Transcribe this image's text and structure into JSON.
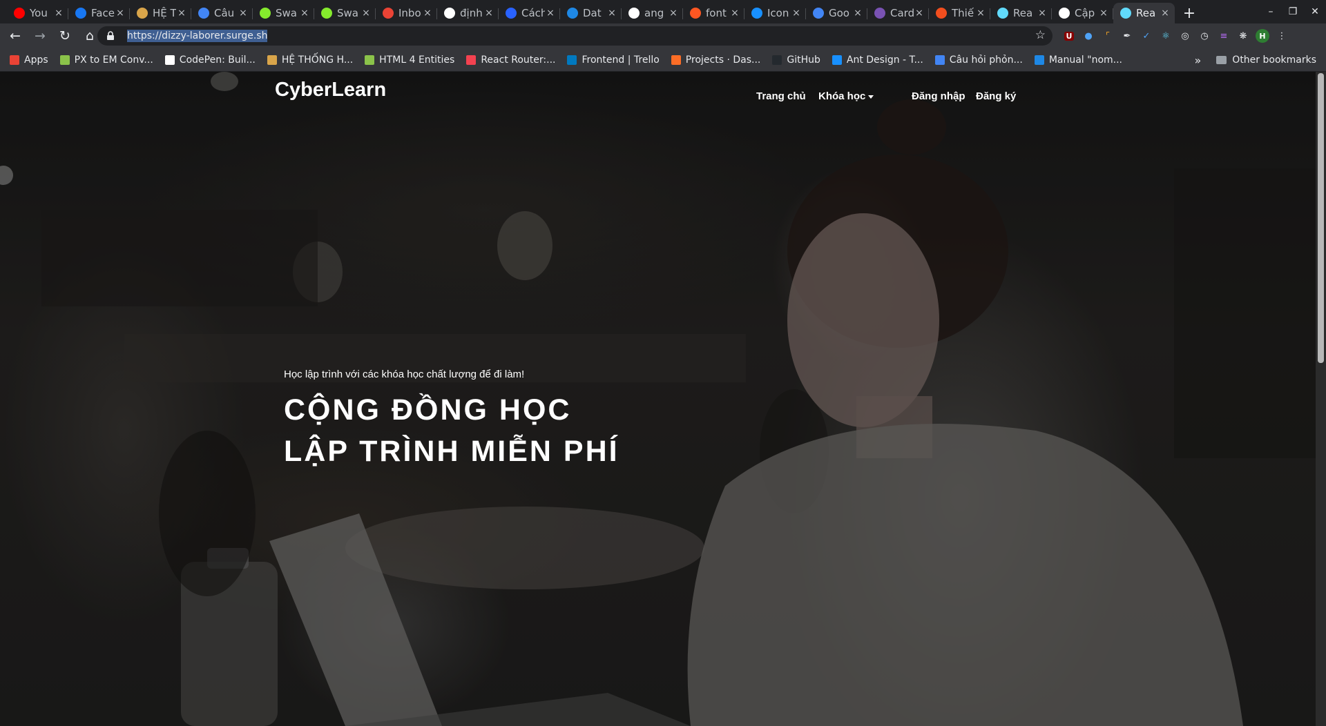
{
  "browser": {
    "tabs": [
      {
        "title": "You",
        "icon": "youtube-icon",
        "color": "#ff0000"
      },
      {
        "title": "Face",
        "icon": "facebook-icon",
        "color": "#1877f2"
      },
      {
        "title": "HỆ T",
        "icon": "box-icon",
        "color": "#d9a54a"
      },
      {
        "title": "Câu",
        "icon": "docs-icon",
        "color": "#4285f4"
      },
      {
        "title": "Swa",
        "icon": "swagger-icon",
        "color": "#85ea2d"
      },
      {
        "title": "Swa",
        "icon": "swagger-icon",
        "color": "#85ea2d"
      },
      {
        "title": "Inbo",
        "icon": "gmail-icon",
        "color": "#ea4335"
      },
      {
        "title": "định",
        "icon": "google-icon",
        "color": "#ffffff"
      },
      {
        "title": "Cách",
        "icon": "hashnode-icon",
        "color": "#2962ff"
      },
      {
        "title": "Dat",
        "icon": "datetime-icon",
        "color": "#1e88e5"
      },
      {
        "title": "ang",
        "icon": "google-icon",
        "color": "#ffffff"
      },
      {
        "title": "font",
        "icon": "code-icon",
        "color": "#ff5722"
      },
      {
        "title": "Icon",
        "icon": "antdesign-icon",
        "color": "#1890ff"
      },
      {
        "title": "Goo",
        "icon": "translate-icon",
        "color": "#4285f4"
      },
      {
        "title": "Card",
        "icon": "bootstrap-icon",
        "color": "#7952b3"
      },
      {
        "title": "Thiế",
        "icon": "figma-icon",
        "color": "#f24e1e"
      },
      {
        "title": "Rea",
        "icon": "react-icon",
        "color": "#61dafb"
      },
      {
        "title": "Cập",
        "icon": "globe-icon",
        "color": "#ffffff"
      },
      {
        "title": "Rea",
        "icon": "react-icon",
        "color": "#61dafb",
        "active": true
      }
    ],
    "new_tab": "+",
    "url_highlighted": "https://dizzy-laborer.surge.sh",
    "bookmarks": [
      {
        "label": "Apps",
        "icon": "apps-grid-icon",
        "color": "#ea4335"
      },
      {
        "label": "PX to EM Conv...",
        "icon": "px-to-em-icon",
        "color": "#8bc34a"
      },
      {
        "label": "CodePen: Buil...",
        "icon": "codepen-icon",
        "color": "#ffffff"
      },
      {
        "label": "HỆ THỐNG H...",
        "icon": "box-icon",
        "color": "#d9a54a"
      },
      {
        "label": "HTML 4 Entities",
        "icon": "html-entities-icon",
        "color": "#8bc34a"
      },
      {
        "label": "React Router:...",
        "icon": "react-router-icon",
        "color": "#f44250"
      },
      {
        "label": "Frontend | Trello",
        "icon": "trello-icon",
        "color": "#0079bf"
      },
      {
        "label": "Projects · Das...",
        "icon": "gitlab-icon",
        "color": "#fc6d26"
      },
      {
        "label": "GitHub",
        "icon": "github-icon",
        "color": "#24292e"
      },
      {
        "label": "Ant Design - T...",
        "icon": "antdesign-icon",
        "color": "#1890ff"
      },
      {
        "label": "Câu hỏi phỏn...",
        "icon": "docs-icon",
        "color": "#4285f4"
      },
      {
        "label": "Manual \"nom...",
        "icon": "npm-icon",
        "color": "#1e88e5"
      }
    ],
    "bookmarks_more": "»",
    "other_bookmarks": "Other bookmarks"
  },
  "site": {
    "brand": "CyberLearn",
    "nav": {
      "home": "Trang chủ",
      "courses": "Khóa học",
      "login": "Đăng nhập",
      "register": "Đăng ký"
    },
    "hero": {
      "subtitle": "Học lập trình với các khóa học chất lượng để đi làm!",
      "title_line1": "CỘNG ĐỒNG HỌC",
      "title_line2": "LẬP TRÌNH MIỄN PHÍ"
    }
  }
}
